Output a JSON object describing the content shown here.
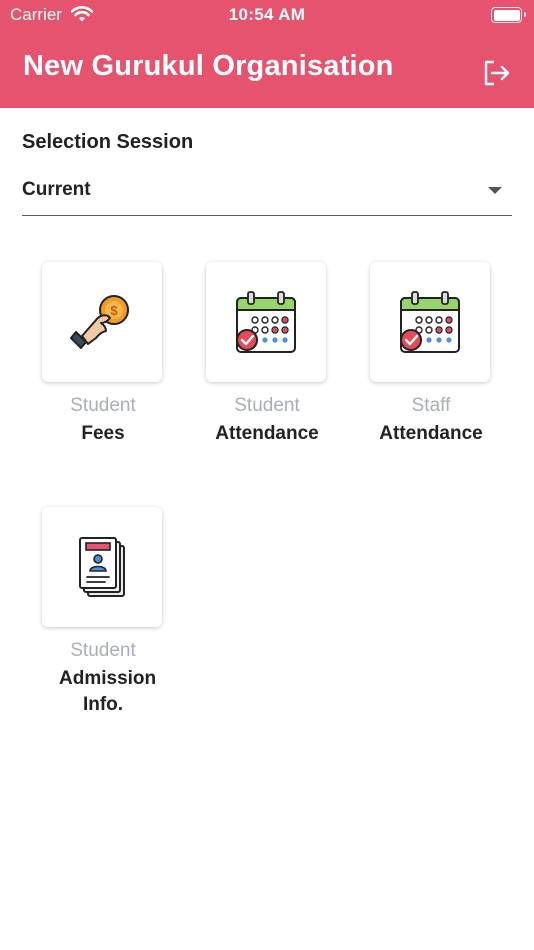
{
  "status_bar": {
    "carrier": "Carrier",
    "time": "10:54 AM"
  },
  "header": {
    "title": "New Gurukul Organisation",
    "logout_icon": "logout-icon"
  },
  "session": {
    "label": "Selection Session",
    "value": "Current"
  },
  "tiles": [
    {
      "sub": "Student",
      "main": "Fees",
      "icon": "fees-hand-coin-icon"
    },
    {
      "sub": "Student",
      "main": "Attendance",
      "icon": "calendar-check-icon"
    },
    {
      "sub": "Staff",
      "main": "Attendance",
      "icon": "calendar-check-icon"
    },
    {
      "sub": "Student",
      "main": "Admission Info.",
      "icon": "admission-document-icon"
    }
  ],
  "colors": {
    "header": "#e5536e",
    "subtitle": "#a9aeb8",
    "text": "#222222"
  }
}
